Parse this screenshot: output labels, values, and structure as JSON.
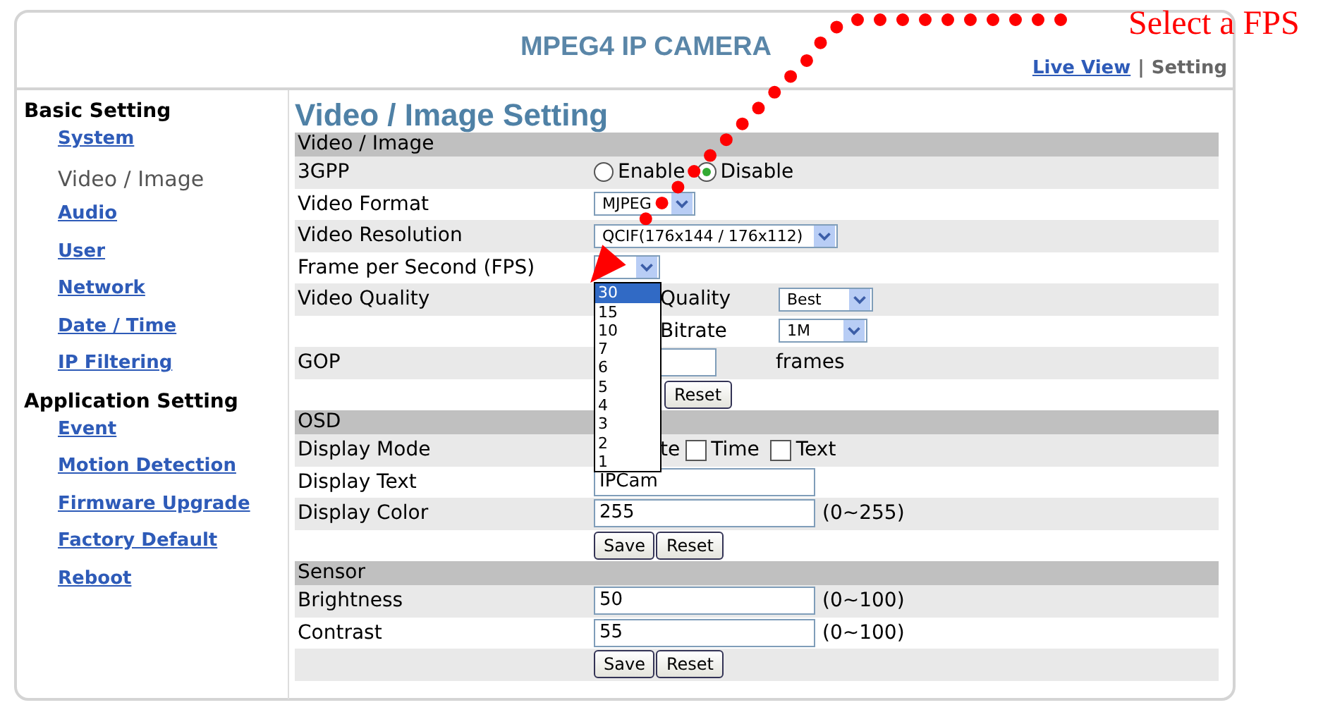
{
  "header": {
    "title": "MPEG4 IP CAMERA",
    "links": [
      {
        "label": "Live View",
        "selected": false
      },
      {
        "label": "Setting",
        "selected": true
      }
    ],
    "separator": "|"
  },
  "sidebar": {
    "groups": [
      {
        "title": "Basic Setting",
        "items": [
          {
            "label": "System",
            "selected": false
          },
          {
            "label": "Video / Image",
            "selected": true
          },
          {
            "label": "Audio",
            "selected": false
          },
          {
            "label": "User",
            "selected": false
          },
          {
            "label": "Network",
            "selected": false
          },
          {
            "label": "Date / Time",
            "selected": false
          },
          {
            "label": "IP Filtering",
            "selected": false
          }
        ]
      },
      {
        "title": "Application Setting",
        "items": [
          {
            "label": "Event",
            "selected": false
          },
          {
            "label": "Motion Detection",
            "selected": false
          },
          {
            "label": "Firmware Upgrade",
            "selected": false
          },
          {
            "label": "Factory Default",
            "selected": false
          },
          {
            "label": "Reboot",
            "selected": false
          }
        ]
      }
    ]
  },
  "content": {
    "title": "Video / Image Setting",
    "sections": [
      {
        "title": "Video / Image",
        "rows": [
          {
            "kind": "radio",
            "label": "3GPP",
            "options": [
              {
                "label": "Enable",
                "selected": false
              },
              {
                "label": "Disable",
                "selected": true
              }
            ]
          },
          {
            "kind": "select",
            "label": "Video Format",
            "value": "MJPEG"
          },
          {
            "kind": "select",
            "label": "Video Resolution",
            "value": "QCIF(176x144 / 176x112)"
          },
          {
            "kind": "dropdown",
            "label": "Frame per Second (FPS)",
            "options": [
              {
                "label": "30",
                "selected": true
              },
              {
                "label": "15",
                "selected": false
              },
              {
                "label": "10",
                "selected": false
              },
              {
                "label": "7",
                "selected": false
              },
              {
                "label": "6",
                "selected": false
              },
              {
                "label": "5",
                "selected": false
              },
              {
                "label": "4",
                "selected": false
              },
              {
                "label": "3",
                "selected": false
              },
              {
                "label": "2",
                "selected": false
              },
              {
                "label": "1",
                "selected": false
              }
            ]
          },
          {
            "kind": "subselect",
            "label": "Video Quality",
            "sublabel": "Quality",
            "value": "Best"
          },
          {
            "kind": "subselect",
            "sublabel": "Bitrate",
            "value": "1M"
          },
          {
            "kind": "gop",
            "label": "GOP",
            "unit": "frames"
          },
          {
            "kind": "buttons",
            "buttons": [
              "Reset"
            ]
          }
        ]
      },
      {
        "title": "OSD",
        "rows": [
          {
            "kind": "checkboxes",
            "label": "Display Mode",
            "prefix": "te",
            "options": [
              {
                "label": "Time",
                "checked": false
              },
              {
                "label": "Text",
                "checked": false
              }
            ]
          },
          {
            "kind": "input",
            "label": "Display Text",
            "value": "IPCam"
          },
          {
            "kind": "input",
            "label": "Display Color",
            "value": "255",
            "range": "(0~255)"
          },
          {
            "kind": "buttons",
            "buttons": [
              "Save",
              "Reset"
            ]
          }
        ]
      },
      {
        "title": "Sensor",
        "rows": [
          {
            "kind": "input",
            "label": "Brightness",
            "value": "50",
            "range": "(0~100)"
          },
          {
            "kind": "input",
            "label": "Contrast",
            "value": "55",
            "range": "(0~100)"
          },
          {
            "kind": "buttons",
            "buttons": [
              "Save",
              "Reset"
            ]
          }
        ]
      }
    ]
  },
  "annotation": {
    "text": "Select a FPS"
  }
}
